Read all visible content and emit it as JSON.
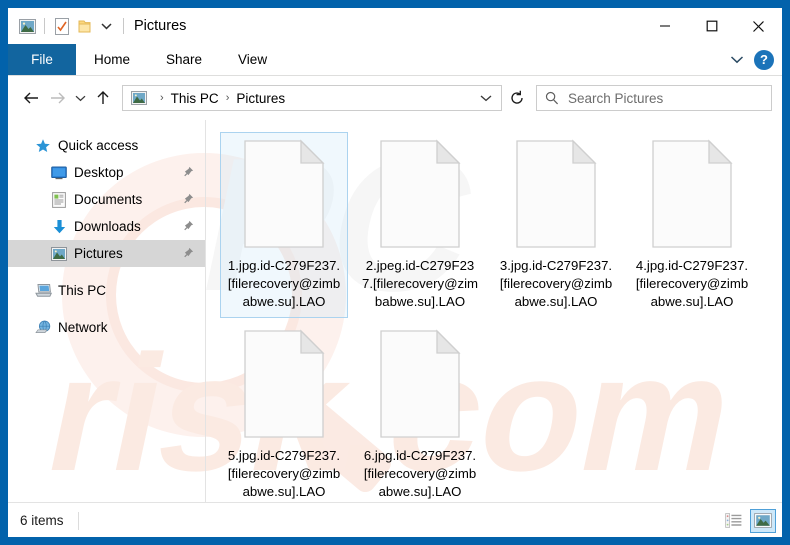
{
  "window": {
    "title": "Pictures",
    "quick_access_toolbar": [
      {
        "name": "pictures-folder-icon",
        "label": "Pictures"
      },
      {
        "name": "properties-icon",
        "label": "Properties"
      },
      {
        "name": "new-folder-icon",
        "label": "New folder"
      },
      {
        "name": "customize-qat-chevron-icon",
        "label": "Customize Quick Access Toolbar"
      }
    ],
    "controls": {
      "minimize": "Minimize",
      "maximize": "Maximize",
      "close": "Close"
    }
  },
  "ribbon": {
    "tabs": [
      {
        "label": "File",
        "active": true
      },
      {
        "label": "Home",
        "active": false
      },
      {
        "label": "Share",
        "active": false
      },
      {
        "label": "View",
        "active": false
      }
    ],
    "expand_label": "Expand the Ribbon",
    "help_label": "?"
  },
  "navigation": {
    "back": "Back",
    "forward": "Forward",
    "recent": "Recent locations",
    "up": "Up",
    "refresh": "Refresh",
    "breadcrumb": [
      "This PC",
      "Pictures"
    ],
    "breadcrumb_separator": "›",
    "dropdown": "Previous locations"
  },
  "search": {
    "placeholder": "Search Pictures",
    "value": ""
  },
  "sidebar": {
    "items": [
      {
        "label": "Quick access",
        "icon": "star-icon",
        "indent": false,
        "pinned": false,
        "selected": false
      },
      {
        "label": "Desktop",
        "icon": "desktop-icon",
        "indent": true,
        "pinned": true,
        "selected": false
      },
      {
        "label": "Documents",
        "icon": "documents-icon",
        "indent": true,
        "pinned": true,
        "selected": false
      },
      {
        "label": "Downloads",
        "icon": "downloads-icon",
        "indent": true,
        "pinned": true,
        "selected": false
      },
      {
        "label": "Pictures",
        "icon": "pictures-icon",
        "indent": true,
        "pinned": true,
        "selected": true
      },
      {
        "label": "This PC",
        "icon": "this-pc-icon",
        "indent": false,
        "pinned": false,
        "selected": false
      },
      {
        "label": "Network",
        "icon": "network-icon",
        "indent": false,
        "pinned": false,
        "selected": false
      }
    ]
  },
  "files": [
    {
      "name": "1.jpg.id-C279F237.[filerecovery@zimbabwe.su].LAO",
      "icon": "blank-file-icon",
      "selected": true
    },
    {
      "name": "2.jpeg.id-C279F237.[filerecovery@zimbabwe.su].LAO",
      "icon": "blank-file-icon",
      "selected": false
    },
    {
      "name": "3.jpg.id-C279F237.[filerecovery@zimbabwe.su].LAO",
      "icon": "blank-file-icon",
      "selected": false
    },
    {
      "name": "4.jpg.id-C279F237.[filerecovery@zimbabwe.su].LAO",
      "icon": "blank-file-icon",
      "selected": false
    },
    {
      "name": "5.jpg.id-C279F237.[filerecovery@zimbabwe.su].LAO",
      "icon": "blank-file-icon",
      "selected": false
    },
    {
      "name": "6.jpg.id-C279F237.[filerecovery@zimbabwe.su].LAO",
      "icon": "blank-file-icon",
      "selected": false
    }
  ],
  "statusbar": {
    "item_count": "6 items",
    "views": [
      {
        "name": "details-view-button",
        "label": "Details view",
        "active": false
      },
      {
        "name": "large-icons-view-button",
        "label": "Large icons view",
        "active": true
      }
    ]
  },
  "watermark": {
    "text": "risk.com",
    "color": "#fae9e4"
  },
  "colors": {
    "frame_blue": "#0262ab",
    "file_tab_blue": "#12659f",
    "selection_border": "#abd3ef",
    "selection_fill": "#cde8f9",
    "sidebar_selected": "#d6d6d6",
    "help_blue": "#1b73b9"
  }
}
